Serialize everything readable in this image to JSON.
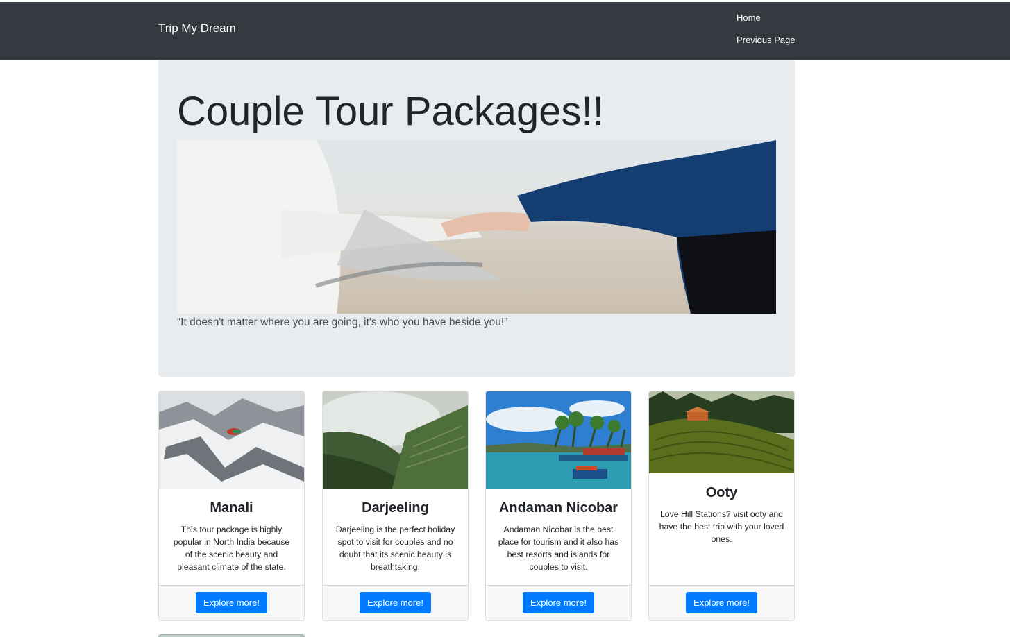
{
  "navbar": {
    "brand": "Trip My Dream",
    "links": [
      {
        "label": "Home"
      },
      {
        "label": "Previous Page"
      }
    ]
  },
  "jumbotron": {
    "title": "Couple Tour Packages!!",
    "quote": "“It doesn't matter where you are going, it's who you have beside you!”"
  },
  "cards": [
    {
      "title": "Manali",
      "text": "This tour package is highly popular in North India because of the scenic beauty and pleasant climate of the state.",
      "button": "Explore more!"
    },
    {
      "title": "Darjeeling",
      "text": "Darjeeling is the perfect holiday spot to visit for couples and no doubt that its scenic beauty is breathtaking.",
      "button": "Explore more!"
    },
    {
      "title": "Andaman Nicobar",
      "text": "Andaman Nicobar is the best place for tourism and it also has best resorts and islands for couples to visit.",
      "button": "Explore more!"
    },
    {
      "title": "Ooty",
      "text": "Love Hill Stations? visit ooty and have the best trip with your loved ones.",
      "button": "Explore more!"
    }
  ],
  "colors": {
    "navbar": "#343a40",
    "jumbotron": "#e9ecef",
    "primary": "#007bff"
  }
}
